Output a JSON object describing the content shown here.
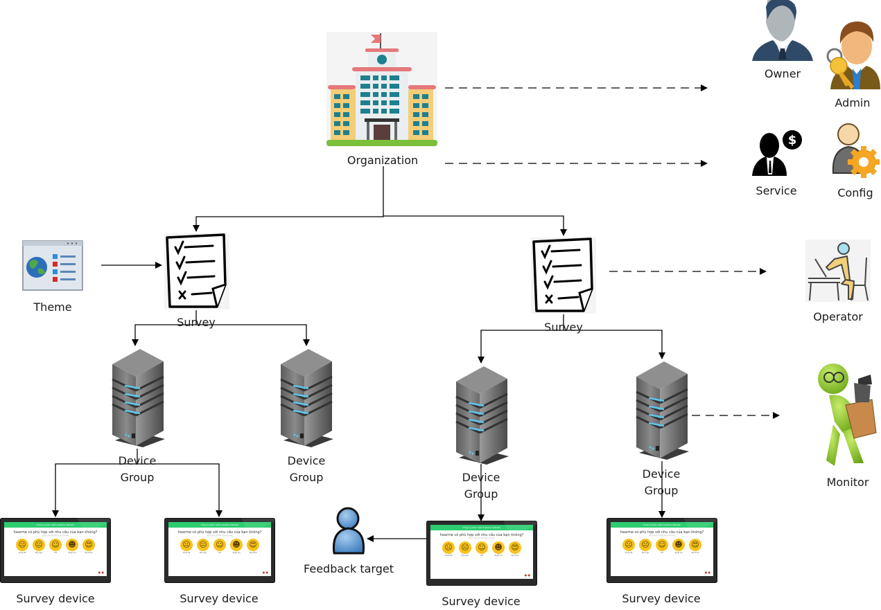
{
  "diagram": {
    "nodes": {
      "organization": {
        "label": "Organization"
      },
      "owner": {
        "label": "Owner"
      },
      "admin": {
        "label": "Admin"
      },
      "service": {
        "label": "Service"
      },
      "config": {
        "label": "Config"
      },
      "theme": {
        "label": "Theme"
      },
      "survey_left": {
        "label": "Survey"
      },
      "survey_right": {
        "label": "Survey"
      },
      "operator": {
        "label": "Operator"
      },
      "monitor": {
        "label": "Monitor"
      },
      "device_group_1": {
        "label_line1": "Device",
        "label_line2": "Group"
      },
      "device_group_2": {
        "label_line1": "Device",
        "label_line2": "Group"
      },
      "device_group_3": {
        "label_line1": "Device",
        "label_line2": "Group"
      },
      "device_group_4": {
        "label_line1": "Device",
        "label_line2": "Group"
      },
      "feedback_target": {
        "label": "Feedback target"
      },
      "survey_device_1": {
        "label": "Survey device"
      },
      "survey_device_2": {
        "label": "Survey device"
      },
      "survey_device_3": {
        "label": "Survey device"
      },
      "survey_device_4": {
        "label": "Survey device"
      }
    },
    "survey_screen": {
      "header": "Công ty phần mềm hearme Vietnam",
      "question": "hearme có phù hợp với nhu cầu của bạn không?",
      "subtitle": "Chọn mức độ hài lòng của bạn",
      "options": [
        {
          "icon": "sad-face-icon",
          "glyph": "☹",
          "label": "Chưa tốt"
        },
        {
          "icon": "neutral-face-icon",
          "glyph": "😐",
          "label": "Phù hợp"
        },
        {
          "icon": "smile-face-icon",
          "glyph": "☺",
          "label": "Tốt"
        },
        {
          "icon": "grin-face-icon",
          "glyph": "☻",
          "label": "Tuyệt vời"
        },
        {
          "icon": "heart-eyes-face-icon",
          "glyph": "😍",
          "label": "Yêu thích"
        }
      ]
    },
    "edges": [
      {
        "from": "organization",
        "to": "owner_admin_group",
        "style": "dashed"
      },
      {
        "from": "organization",
        "to": "service_config_group",
        "style": "dashed"
      },
      {
        "from": "organization",
        "to": "survey_left",
        "style": "solid"
      },
      {
        "from": "organization",
        "to": "survey_right",
        "style": "solid"
      },
      {
        "from": "theme",
        "to": "survey_left",
        "style": "solid"
      },
      {
        "from": "survey_right",
        "to": "operator",
        "style": "dashed"
      },
      {
        "from": "survey_left",
        "to": "device_group_1",
        "style": "solid"
      },
      {
        "from": "survey_left",
        "to": "device_group_2",
        "style": "solid"
      },
      {
        "from": "survey_right",
        "to": "device_group_3",
        "style": "solid"
      },
      {
        "from": "survey_right",
        "to": "device_group_4",
        "style": "solid"
      },
      {
        "from": "device_group_4",
        "to": "monitor",
        "style": "dashed"
      },
      {
        "from": "device_group_1",
        "to": "survey_device_1",
        "style": "solid"
      },
      {
        "from": "device_group_1",
        "to": "survey_device_2",
        "style": "solid"
      },
      {
        "from": "device_group_3",
        "to": "survey_device_3",
        "style": "solid"
      },
      {
        "from": "device_group_4",
        "to": "survey_device_4",
        "style": "solid"
      },
      {
        "from": "survey_device_3",
        "to": "feedback_target",
        "style": "solid"
      }
    ]
  }
}
